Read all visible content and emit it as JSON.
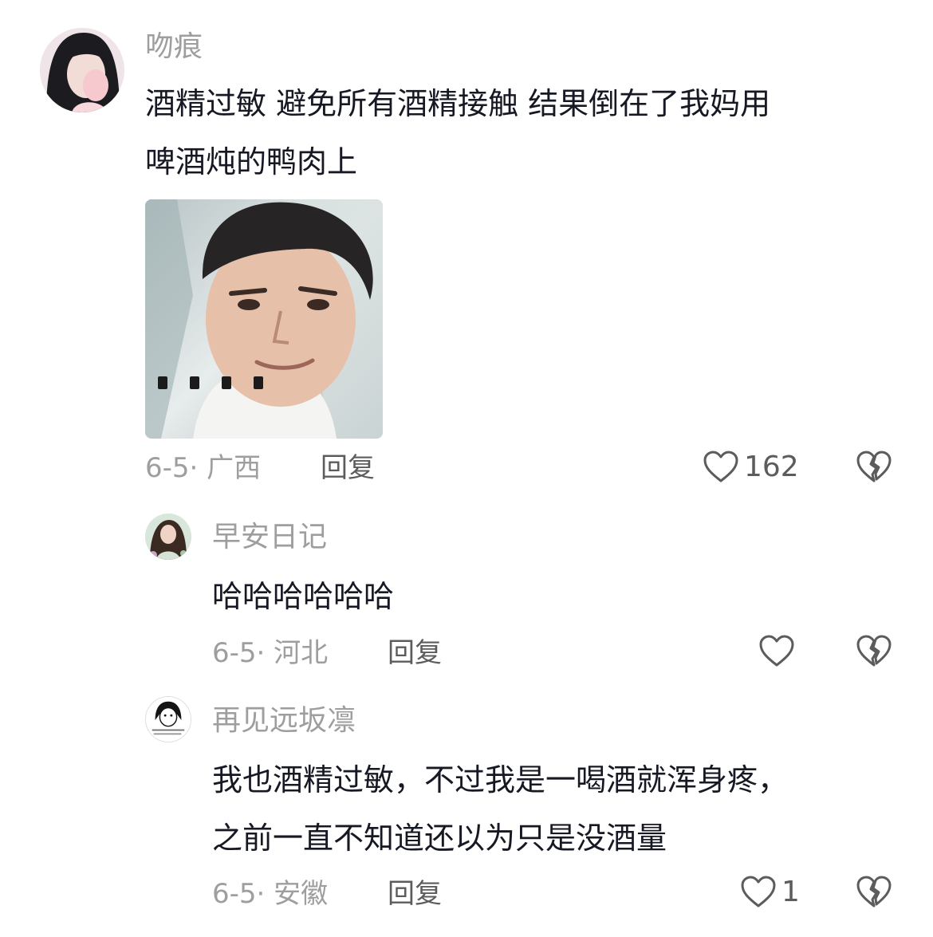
{
  "comment": {
    "username": "吻痕",
    "text_lines": [
      "酒精过敏 避免所有酒精接触 结果倒在了我妈用",
      "啤酒炖的鸭肉上"
    ],
    "date_location": "6-5· 广西",
    "reply_label": "回复",
    "like_count": "162",
    "avatar_icon": "user-avatar-girl",
    "media_icon": "meme-image",
    "like_icon": "heart-outline-icon",
    "dislike_icon": "broken-heart-icon"
  },
  "replies": [
    {
      "username": "早安日记",
      "text_lines": [
        "哈哈哈哈哈哈"
      ],
      "date_location": "6-5· 河北",
      "reply_label": "回复",
      "like_count": "",
      "avatar_icon": "user-avatar-portrait"
    },
    {
      "username": "再见远坂凛",
      "text_lines": [
        "我也酒精过敏，不过我是一喝酒就浑身疼，",
        "之前一直不知道还以为只是没酒量"
      ],
      "date_location": "6-5· 安徽",
      "reply_label": "回复",
      "like_count": "1",
      "avatar_icon": "user-avatar-cartoon"
    }
  ],
  "colors": {
    "primary_text": "#161823",
    "secondary_text": "#9e9e9e",
    "action_text": "#5c5c5c",
    "background": "#ffffff"
  }
}
